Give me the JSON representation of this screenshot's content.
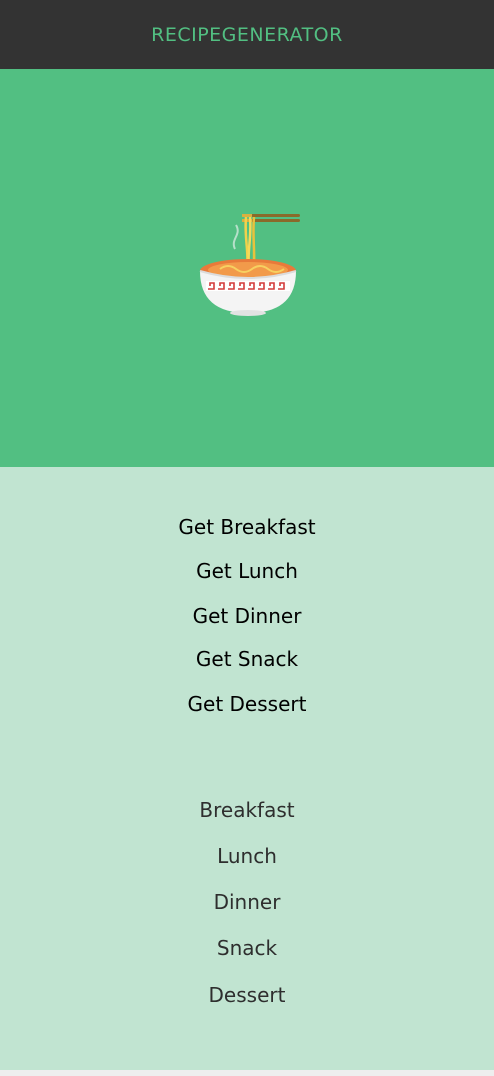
{
  "header": {
    "title": "RECIPEGENERATOR"
  },
  "hero": {
    "icon": "noodle-bowl-icon"
  },
  "actions": [
    {
      "label": "Get Breakfast"
    },
    {
      "label": "Get Lunch"
    },
    {
      "label": "Get Dinner"
    },
    {
      "label": "Get Snack"
    },
    {
      "label": "Get Dessert"
    }
  ],
  "categories": [
    {
      "label": "Breakfast"
    },
    {
      "label": "Lunch"
    },
    {
      "label": "Dinner"
    },
    {
      "label": "Snack"
    },
    {
      "label": "Dessert"
    }
  ],
  "colors": {
    "header_bg": "#333333",
    "brand": "#52bf82",
    "hero_bg": "#52bf82",
    "content_bg": "#c1e4d1"
  }
}
